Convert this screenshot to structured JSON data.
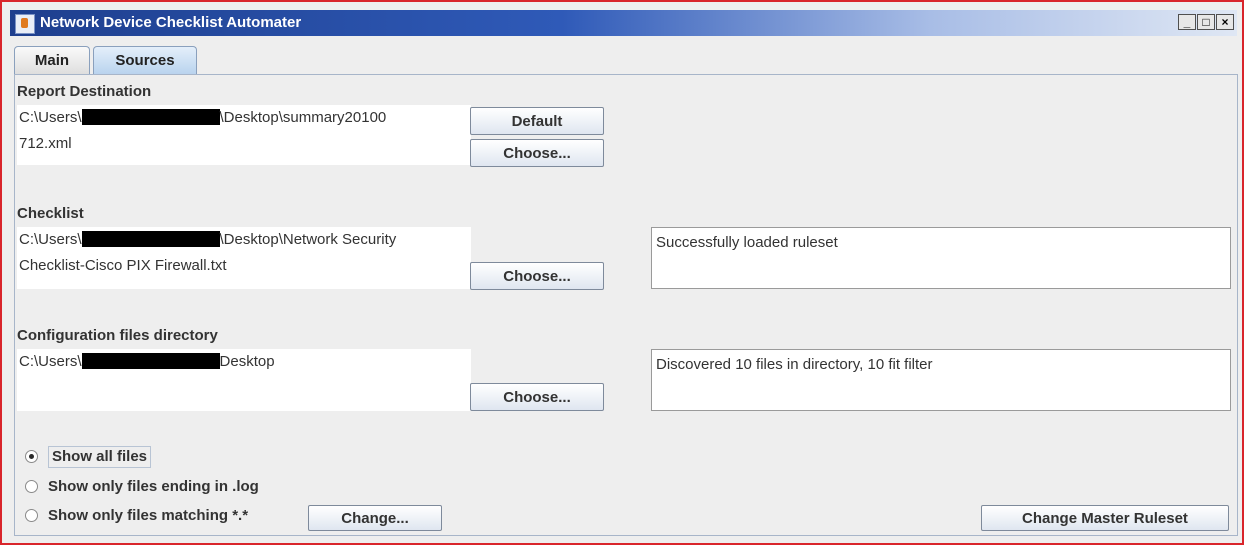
{
  "window": {
    "title": "Network Device Checklist Automater",
    "controls": {
      "minimize": "_",
      "maximize": "□",
      "close": "×"
    }
  },
  "tabs": [
    {
      "label": "Main",
      "active": false
    },
    {
      "label": "Sources",
      "active": true
    }
  ],
  "report_destination": {
    "label": "Report Destination",
    "path_prefix": "C:\\Users\\",
    "path_line1_suffix": "\\Desktop\\summary20100",
    "path_line2": "712.xml",
    "default_button": "Default",
    "choose_button": "Choose..."
  },
  "checklist": {
    "label": "Checklist",
    "path_prefix": "C:\\Users\\",
    "path_line1_suffix": "\\Desktop\\Network Security",
    "path_line2": "Checklist-Cisco PIX Firewall.txt",
    "choose_button": "Choose...",
    "status": "Successfully loaded ruleset"
  },
  "config_dir": {
    "label": "Configuration files directory",
    "path_prefix": "C:\\Users\\",
    "path_line1_suffix": "Desktop",
    "choose_button": "Choose...",
    "status": "Discovered 10 files in directory, 10 fit filter"
  },
  "filters": {
    "options": [
      {
        "label": "Show all files",
        "selected": true
      },
      {
        "label": "Show only files ending in .log",
        "selected": false
      },
      {
        "label": "Show only files matching *.*",
        "selected": false
      }
    ],
    "change_button": "Change..."
  },
  "change_master_ruleset_button": "Change Master Ruleset",
  "colors": {
    "accent_border": "#d9252b",
    "titlebar": "#1e3f8e",
    "active_tab": "#b9d3ee"
  }
}
